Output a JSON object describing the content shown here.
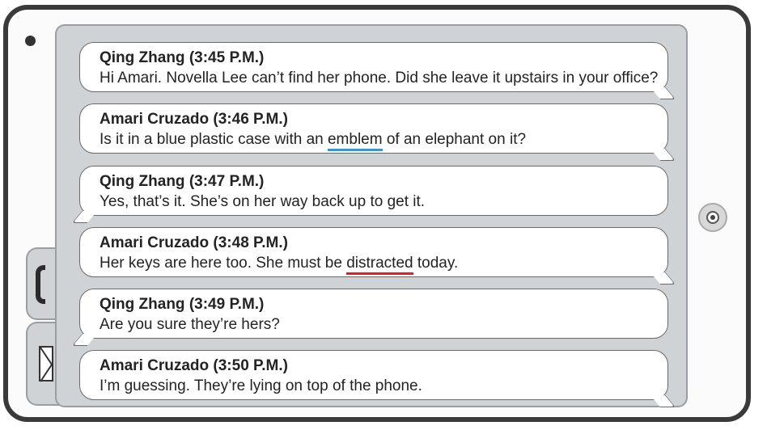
{
  "messages": [
    {
      "sender": "Qing Zhang (3:45 P.M.)",
      "pre": "Hi Amari. Novella Lee can’t find her phone. Did she leave it upstairs in your office?",
      "highlight": "",
      "post": ""
    },
    {
      "sender": "Amari Cruzado (3:46 P.M.)",
      "pre": "Is it in a blue plastic case with an ",
      "highlight": "emblem",
      "post": " of an elephant on it?"
    },
    {
      "sender": "Qing Zhang (3:47 P.M.)",
      "pre": "Yes, that’s it. She’s on her way back up to get it.",
      "highlight": "",
      "post": ""
    },
    {
      "sender": "Amari Cruzado (3:48 P.M.)",
      "pre": "Her keys are here too. She must be ",
      "highlight": "distracted",
      "post": " today."
    },
    {
      "sender": "Qing Zhang (3:49 P.M.)",
      "pre": "Are you sure they’re hers?",
      "highlight": "",
      "post": ""
    },
    {
      "sender": "Amari Cruzado (3:50 P.M.)",
      "pre": "I’m guessing. They’re lying on top of the phone.",
      "highlight": "",
      "post": ""
    }
  ],
  "colors": {
    "underline_blue": "#2a9ad8",
    "underline_red": "#d8232a"
  },
  "icons": {
    "phone_tab": "phone-icon",
    "mail_tab": "mail-icon",
    "home": "home-button-icon",
    "camera": "camera-icon"
  }
}
